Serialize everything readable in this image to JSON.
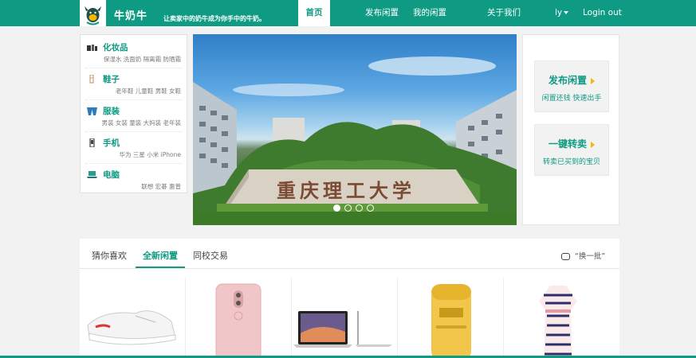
{
  "header": {
    "brand": "牛奶牛",
    "slogan": "让卖家中的奶牛成为你手中的牛奶。",
    "nav": {
      "home": "首页",
      "publish": "发布闲置",
      "my_idle": "我的闲置",
      "about": "关于我们",
      "user": "ly",
      "logout": "Login out"
    }
  },
  "categories": [
    {
      "title": "化妆品",
      "sub": "保湿水 洗面奶 隔离霜 防晒霜"
    },
    {
      "title": "鞋子",
      "sub": "老年鞋 儿童鞋 男鞋 女鞋"
    },
    {
      "title": "服装",
      "sub": "男装 女装 童装 大妈装 老年装"
    },
    {
      "title": "手机",
      "sub": "华为 三星 小米 iPhone"
    },
    {
      "title": "电脑",
      "sub": "联想 宏碁 惠普"
    }
  ],
  "banner": {
    "gate_text": "重庆理工大学",
    "slides": 4,
    "active_slide": 1
  },
  "actions": {
    "publish": {
      "title": "发布闲置",
      "sub": "闲置还钱  快速出手"
    },
    "resell": {
      "title": "一键转卖",
      "sub": "转卖已买到的宝贝"
    }
  },
  "recommend": {
    "tabs": [
      "猜你喜欢",
      "全新闲置",
      "同校交易"
    ],
    "active_tab": 1,
    "refresh": "“换一批”",
    "products": [
      "sneaker-image",
      "pink-phone-image",
      "laptop-image",
      "sunscreen-image",
      "striped-dress-image"
    ]
  },
  "colors": {
    "accent": "#0e9a83",
    "arrow": "#f5b800"
  }
}
